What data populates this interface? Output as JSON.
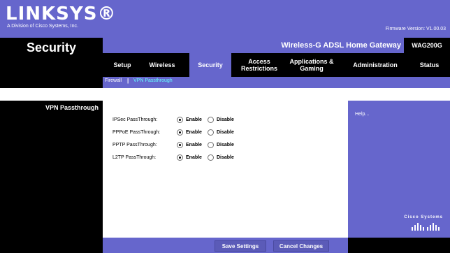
{
  "header": {
    "brand": "LINKSYS®",
    "brand_sub": "A Division of Cisco Systems, Inc.",
    "firmware": "Firmware Version: V1.00.03",
    "product_name": "Wireless-G ADSL Home Gateway",
    "model": "WAG200G",
    "section_title": "Security"
  },
  "tabs": [
    {
      "label": "Setup"
    },
    {
      "label": "Wireless"
    },
    {
      "label": "Security"
    },
    {
      "label": "Access Restrictions"
    },
    {
      "label": "Applications & Gaming"
    },
    {
      "label": "Administration"
    },
    {
      "label": "Status"
    }
  ],
  "subtabs": {
    "firewall": "Firewall",
    "separator": "|",
    "vpn": "VPN Passthrough"
  },
  "sidebar": {
    "heading": "VPN Passthrough"
  },
  "form": {
    "rows": [
      {
        "label": "IPSec PassThrough:",
        "enable": "Enable",
        "disable": "Disable",
        "selected": "enable"
      },
      {
        "label": "PPPoE PassThrough:",
        "enable": "Enable",
        "disable": "Disable",
        "selected": "enable"
      },
      {
        "label": "PPTP PassThrough:",
        "enable": "Enable",
        "disable": "Disable",
        "selected": "enable"
      },
      {
        "label": "L2TP PassThrough:",
        "enable": "Enable",
        "disable": "Disable",
        "selected": "enable"
      }
    ]
  },
  "help": {
    "link": "Help...",
    "cisco": "Cisco Systems"
  },
  "footer": {
    "save_label": "Save Settings",
    "cancel_label": "Cancel Changes"
  },
  "colors": {
    "accent": "#6666cc",
    "black": "#000000",
    "selected_subtab": "#66ffff"
  }
}
